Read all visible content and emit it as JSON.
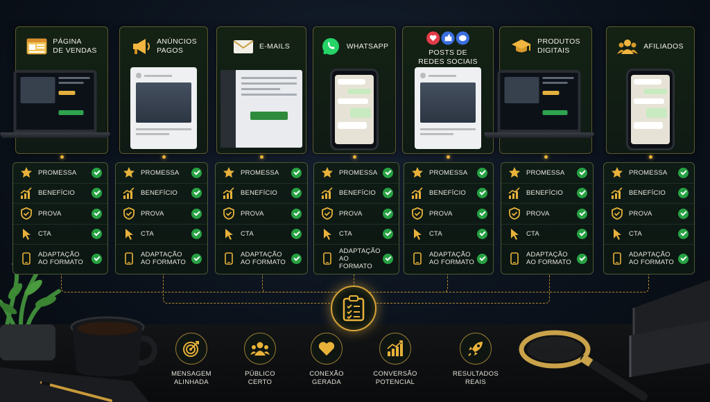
{
  "channels": [
    {
      "id": "pagina",
      "title": "Página\nde vendas",
      "icon": "browser-page-icon",
      "device": "laptop"
    },
    {
      "id": "anuncios",
      "title": "Anúncios\npagos",
      "icon": "megaphone-icon",
      "device": "paper"
    },
    {
      "id": "emails",
      "title": "E-mails",
      "icon": "envelope-icon",
      "device": "email-window"
    },
    {
      "id": "whatsapp",
      "title": "WhatsApp",
      "icon": "whatsapp-icon",
      "device": "phone"
    },
    {
      "id": "redes",
      "title": "Posts de\nredes sociais",
      "icon": "social-reactions-icon",
      "device": "paper"
    },
    {
      "id": "produtos",
      "title": "Produtos\ndigitais",
      "icon": "graduation-cap-icon",
      "device": "laptop"
    },
    {
      "id": "afiliados",
      "title": "Afiliados",
      "icon": "people-group-icon",
      "device": "phone"
    }
  ],
  "checklist": [
    {
      "label": "Promessa",
      "icon": "star-icon"
    },
    {
      "label": "Benefício",
      "icon": "growth-chart-icon"
    },
    {
      "label": "Prova",
      "icon": "shield-icon"
    },
    {
      "label": "CTA",
      "icon": "cursor-icon"
    },
    {
      "label": "Adaptação\nao formato",
      "icon": "smartphone-icon"
    }
  ],
  "device_texts": {
    "whatsapp_window": "",
    "cta_button": ""
  },
  "results": [
    {
      "label": "Mensagem\nalinhada",
      "icon": "target-icon"
    },
    {
      "label": "Público\ncerto",
      "icon": "audience-icon"
    },
    {
      "label": "Conexão\ngerada",
      "icon": "heart-icon"
    },
    {
      "label": "Conversão\npotencial",
      "icon": "conversion-chart-icon"
    },
    {
      "label": "Resultados\nreais",
      "icon": "rocket-icon"
    }
  ],
  "colors": {
    "accent_gold": "#e8b23a",
    "check_green": "#27a143",
    "card_border": "#5c5a2e",
    "background": "#0b121c"
  }
}
